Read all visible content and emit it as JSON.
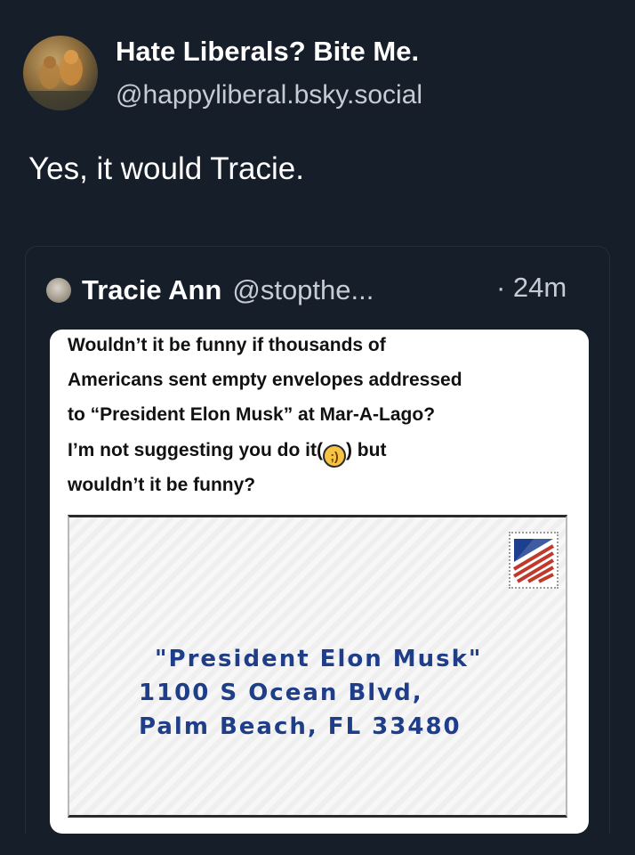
{
  "post": {
    "display_name": "Hate Liberals? Bite Me.",
    "handle": "@happyliberal.bsky.social",
    "text": "Yes, it would Tracie."
  },
  "quote": {
    "name": "Tracie Ann",
    "handle": "@stopthe...",
    "time": "· 24m"
  },
  "embedded_tweet": {
    "lines": [
      "Wouldn’t it be funny if thousands of",
      "Americans sent empty envelopes addressed",
      "to “President Elon Musk” at Mar-A-Lago?",
      "wouldn’t it be funny?"
    ],
    "line4_before": "I’m not suggesting you do it(",
    "line4_after": ") but",
    "emoji": "winking-face"
  },
  "envelope": {
    "address": [
      "\"President Elon Musk\"",
      "1100 S Ocean Blvd,",
      "Palm Beach, FL 33480"
    ]
  },
  "colors": {
    "background": "#161e2a",
    "address_ink": "#1f3e8a",
    "stamp_red": "#c0392b",
    "stamp_blue": "#1d3f8f"
  }
}
